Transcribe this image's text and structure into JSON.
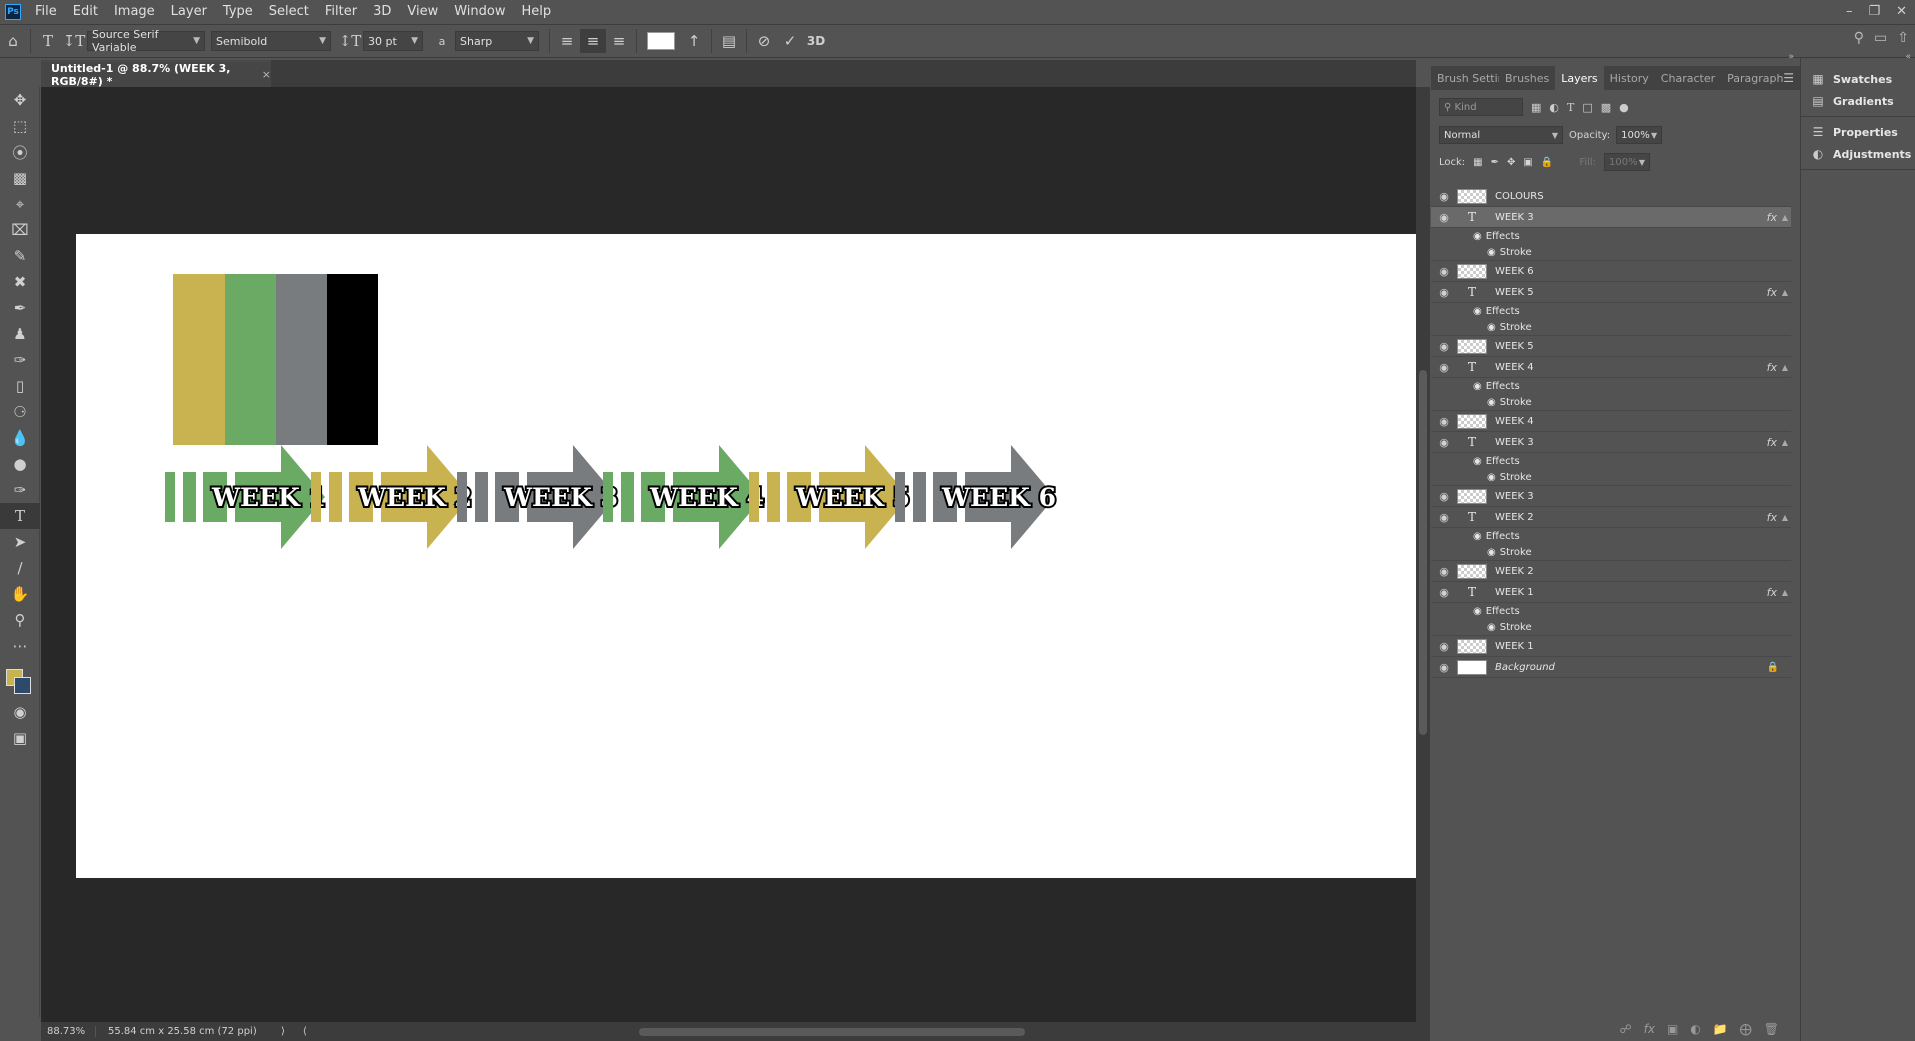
{
  "app": {
    "menus": [
      "File",
      "Edit",
      "Image",
      "Layer",
      "Type",
      "Select",
      "Filter",
      "3D",
      "View",
      "Window",
      "Help"
    ]
  },
  "options_bar": {
    "font_family": "Source Serif Variable",
    "font_style": "Semibold",
    "font_size": "30 pt",
    "antialias_label": "a",
    "antialias": "Sharp",
    "text_color": "#ffffff",
    "three_d": "3D"
  },
  "document": {
    "tab_title": "Untitled-1 @ 88.7% (WEEK 3, RGB/8#) *"
  },
  "canvas": {
    "palette_colors": [
      "#c8b350",
      "#6aaa64",
      "#787c7e",
      "#000000"
    ],
    "weeks": [
      "WEEK 1",
      "WEEK 2",
      "WEEK 3",
      "WEEK 4",
      "WEEK 5",
      "WEEK 6"
    ],
    "week_colors": [
      "#6aaa64",
      "#c8b350",
      "#787c7e",
      "#6aaa64",
      "#c8b350",
      "#787c7e"
    ]
  },
  "status": {
    "zoom": "88.73%",
    "doc_info": "55.84 cm x 25.58 cm (72 ppi)"
  },
  "panel": {
    "tabs": [
      "Brush Settings",
      "Brushes",
      "Layers",
      "History",
      "Character",
      "Paragraph"
    ],
    "active_tab": "Layers",
    "kind_placeholder": "Kind",
    "blend_mode": "Normal",
    "opacity_label": "Opacity:",
    "opacity": "100%",
    "lock_label": "Lock:",
    "fill_label": "Fill:",
    "fill": "100%",
    "layers": [
      {
        "name": "COLOURS",
        "type": "pixel"
      },
      {
        "name": "WEEK 3",
        "type": "text",
        "fx": true,
        "selected": true
      },
      {
        "name": "WEEK 6",
        "type": "pixel"
      },
      {
        "name": "WEEK 5",
        "type": "text",
        "fx": true
      },
      {
        "name": "WEEK 5",
        "type": "pixel"
      },
      {
        "name": "WEEK 4",
        "type": "text",
        "fx": true
      },
      {
        "name": "WEEK 4",
        "type": "pixel"
      },
      {
        "name": "WEEK 3",
        "type": "text",
        "fx": true
      },
      {
        "name": "WEEK 3",
        "type": "pixel"
      },
      {
        "name": "WEEK 2",
        "type": "text",
        "fx": true
      },
      {
        "name": "WEEK 2",
        "type": "pixel"
      },
      {
        "name": "WEEK 1",
        "type": "text",
        "fx": true
      },
      {
        "name": "WEEK 1",
        "type": "pixel"
      },
      {
        "name": "Background",
        "type": "background",
        "locked": true
      }
    ],
    "effects_label": "Effects",
    "stroke_label": "Stroke",
    "fx_label": "fx"
  },
  "dock": {
    "items": [
      "Swatches",
      "Gradients",
      "Properties",
      "Adjustments"
    ]
  }
}
